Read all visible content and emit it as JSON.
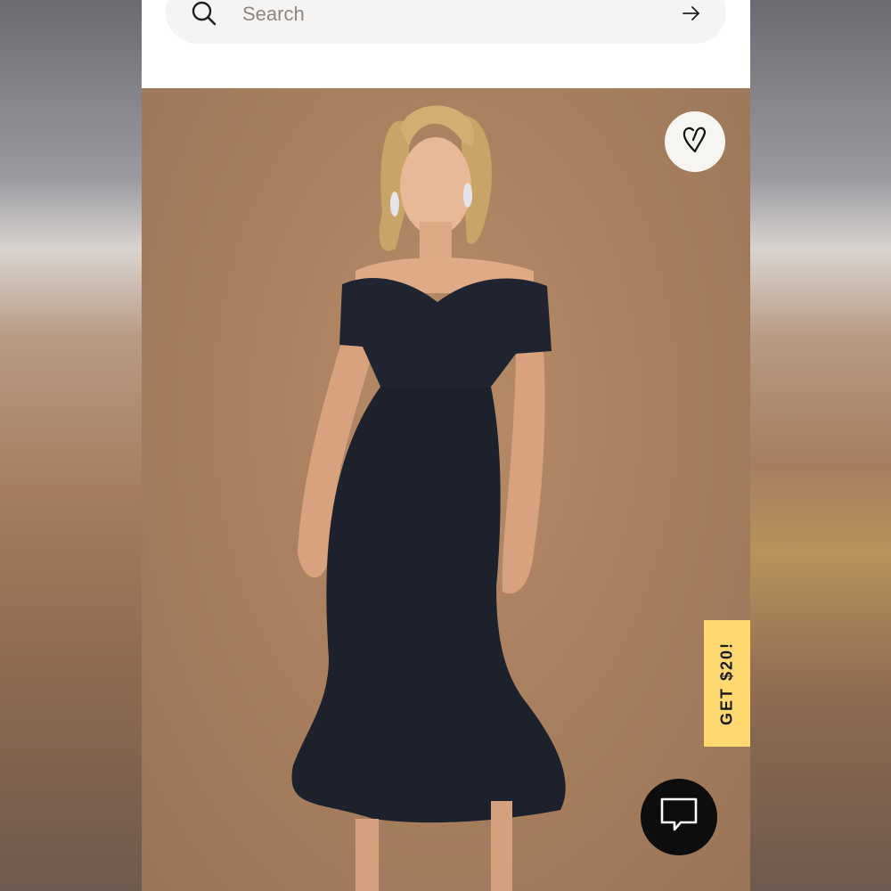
{
  "search": {
    "placeholder": "Search",
    "value": "",
    "icon": "search-icon",
    "submit_icon": "arrow-right-icon"
  },
  "product": {
    "image_subject": "product-photo",
    "wishlist_icon": "heart-icon"
  },
  "promo": {
    "label": "GET $20!",
    "color": "#ffd970"
  },
  "chat": {
    "icon": "chat-bubble-icon",
    "color": "#0d0d0d"
  },
  "colors": {
    "hero_background": "#a98160",
    "dress": "#1f2430"
  }
}
